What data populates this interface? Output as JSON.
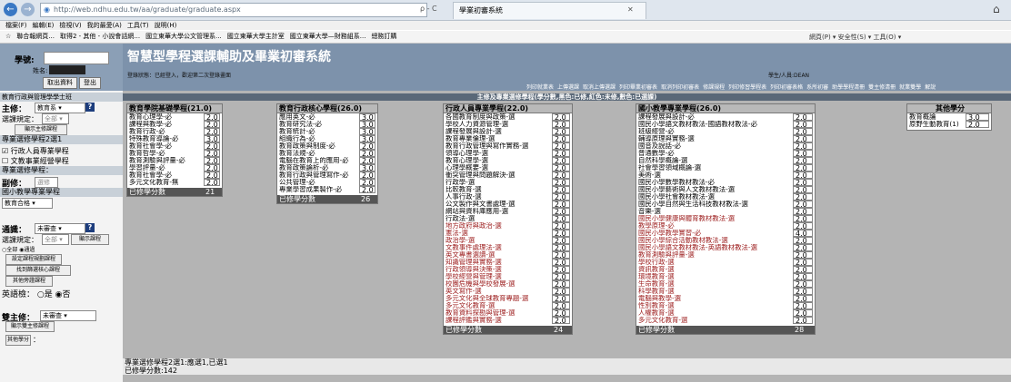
{
  "browser": {
    "url": "http://web.ndhu.edu.tw/aa/graduate/graduate.aspx",
    "tab_title": "學業初審系統",
    "addr_tools": "ρ - C",
    "menu": [
      "檔案(F)",
      "編輯(E)",
      "檢視(V)",
      "我的最愛(A)",
      "工具(T)",
      "說明(H)"
    ],
    "favorites": [
      "聯合報網頁...",
      "取得2 - 其他 - 小說會話網...",
      "國立東華大學公文管理系...",
      "國立東華大學主計室",
      "國立東華大學—財務組系...",
      "總務訂購"
    ],
    "command_bar": "網頁(P) ▾  安全性(S) ▾  工具(O) ▾"
  },
  "header": {
    "system_title": "智慧型學程選課輔助及畢業初審系統",
    "login_info": "登錄狀態：已經登入，歡迎第二次登錄畫面",
    "user_info": "學生/人員:DEAN",
    "sid_label": "學號:",
    "name_label": "姓名:",
    "fetch_button": "取出資料",
    "logout_button": "登出",
    "top_links": [
      "列印就業表",
      "上傳選課",
      "取消上傳選課",
      "列印畢業初審表",
      "取消列印初審表",
      "修課規程",
      "列印修習學程表",
      "列印初審表格",
      "系所初審",
      "助學學程清冊",
      "雙主修清冊",
      "就業雙學",
      "解說"
    ]
  },
  "left": {
    "section_title": "教育行政與管理學學士班",
    "major_label": "主修：",
    "major_value": "教育系",
    "cond_label": "選課規定：",
    "cond_value": "全部",
    "show_major_btn": "顯示主修課程",
    "program_count": "專業選修學程2選1",
    "program1": "行政人員專業學程",
    "program2": "文教事業經營學程",
    "program_title": "專業選修學程：",
    "double_label": "副修：",
    "double_value": "選修",
    "elective_title": "國小教學專業學程",
    "elective_value": "教育合格",
    "general_label": "通識：",
    "general_value": "未審查",
    "general_cond_label": "選課規定：",
    "general_cond_value": "全部",
    "show_general_btn": "顯示課程",
    "radio1": "全部",
    "radio2": "通過",
    "btn1": "設定課程規劃課程",
    "btn2": "找到篩選核心課程",
    "btn3": "其他旁證課程",
    "english_label": "英語檢：",
    "yes": "是",
    "no": "否",
    "dual_label": "雙主修：",
    "dual_value": "未審查",
    "show_dual_btn": "顯示雙主修課程",
    "other_btn": "其他學分",
    "other_suffix": "："
  },
  "main": {
    "heading": "主修及專業選修學程(學分數,黑色:已修,紅色:未修,數色:已選課)",
    "footer_line1": "專業選修學程2選1:應選1,已選1",
    "footer_line2": "已修學分數:142",
    "total_label": "已修學分數",
    "categories": [
      {
        "title": "教育學院基礎學程(21.0)",
        "total": "21",
        "courses": [
          {
            "name": "教育心理學-必",
            "credit": "2.0",
            "taken": true
          },
          {
            "name": "課程與教學-必",
            "credit": "2.0",
            "taken": true
          },
          {
            "name": "教育行政-必",
            "credit": "2.0",
            "taken": true
          },
          {
            "name": "特殊教育導論-必",
            "credit": "3.0",
            "taken": true
          },
          {
            "name": "教育社會學-必",
            "credit": "2.0",
            "taken": true
          },
          {
            "name": "教育哲學-必",
            "credit": "2.0",
            "taken": true
          },
          {
            "name": "教育測驗與評量-必",
            "credit": "2.0",
            "taken": true
          },
          {
            "name": "學習評量-必",
            "credit": "2.0",
            "taken": true
          },
          {
            "name": "教育社會學-必",
            "credit": "2.0",
            "taken": true
          },
          {
            "name": "多元文化教育-無",
            "credit": "2.0",
            "taken": true
          }
        ]
      },
      {
        "title": "教育行政核心學程(26.0)",
        "total": "26",
        "courses": [
          {
            "name": "應用英文-必",
            "credit": "3.0",
            "taken": true
          },
          {
            "name": "教育研究法-必",
            "credit": "3.0",
            "taken": true
          },
          {
            "name": "教育統計-必",
            "credit": "3.0",
            "taken": true
          },
          {
            "name": "組織行為-必",
            "credit": "3.0",
            "taken": true
          },
          {
            "name": "教育政策與制度-必",
            "credit": "2.0",
            "taken": true
          },
          {
            "name": "教育法規-必",
            "credit": "2.0",
            "taken": true
          },
          {
            "name": "電腦在教育上的應用-必",
            "credit": "2.0",
            "taken": true
          },
          {
            "name": "教育政策論析-必",
            "credit": "3.0",
            "taken": true
          },
          {
            "name": "教育行政與管理寫作-必",
            "credit": "2.0",
            "taken": true
          },
          {
            "name": "公共管理-必",
            "credit": "2.0",
            "taken": true
          },
          {
            "name": "專業學習成果製作-必",
            "credit": "2.0",
            "taken": true
          }
        ]
      },
      {
        "title": "行政人員專業學程(22.0)",
        "total": "24",
        "courses": [
          {
            "name": "各國教育制度與政策-選",
            "credit": "2.0",
            "taken": true
          },
          {
            "name": "學校人力資源管理-選",
            "credit": "2.0",
            "taken": true
          },
          {
            "name": "課程發展與設計-選",
            "credit": "2.0",
            "taken": true
          },
          {
            "name": "教育專業倫理-選",
            "credit": "2.0",
            "taken": true
          },
          {
            "name": "教育行政管理與寫作實務-選",
            "credit": "2.0",
            "taken": true
          },
          {
            "name": "領導心理學-選",
            "credit": "2.0",
            "taken": true
          },
          {
            "name": "教育心理學-選",
            "credit": "2.0",
            "taken": true
          },
          {
            "name": "心理學概要-選",
            "credit": "2.0",
            "taken": true
          },
          {
            "name": "衝突管理與問題解決-選",
            "credit": "2.0",
            "taken": true
          },
          {
            "name": "行政學-選",
            "credit": "2.0",
            "taken": true
          },
          {
            "name": "比較教育-選",
            "credit": "2.0",
            "taken": true
          },
          {
            "name": "人事行政-選",
            "credit": "2.0",
            "taken": true
          },
          {
            "name": "公文製作與文書處理-選",
            "credit": "2.0",
            "taken": true
          },
          {
            "name": "網站與資料庫應用-選",
            "credit": "2.0",
            "taken": true
          },
          {
            "name": "行政法-選",
            "credit": "2.0",
            "taken": true
          },
          {
            "name": "地方政府與政治-選",
            "credit": "2.0",
            "taken": false
          },
          {
            "name": "憲法-選",
            "credit": "2.0",
            "taken": false
          },
          {
            "name": "政治學-選",
            "credit": "2.0",
            "taken": false
          },
          {
            "name": "文教事件處理法-選",
            "credit": "2.0",
            "taken": false
          },
          {
            "name": "英文專書選讀-選",
            "credit": "2.0",
            "taken": false
          },
          {
            "name": "知識管理與實務-選",
            "credit": "2.0",
            "taken": false
          },
          {
            "name": "行政領導與決策-選",
            "credit": "2.0",
            "taken": false
          },
          {
            "name": "學校經營與管理-選",
            "credit": "2.0",
            "taken": false
          },
          {
            "name": "校園危機與學校發展-選",
            "credit": "2.0",
            "taken": false
          },
          {
            "name": "英文寫作-選",
            "credit": "2.0",
            "taken": false
          },
          {
            "name": "多元文化與全球教育專題-選",
            "credit": "2.0",
            "taken": false
          },
          {
            "name": "多元文化教育-選",
            "credit": "2.0",
            "taken": false
          },
          {
            "name": "教育資料探勘與管理-選",
            "credit": "2.0",
            "taken": false
          },
          {
            "name": "課程評鑑與實務-選",
            "credit": "2.0",
            "taken": false
          }
        ]
      },
      {
        "title": "國小教學專業學程(26.0)",
        "total": "28",
        "courses": [
          {
            "name": "課程發展與設計-必",
            "credit": "2.0",
            "taken": true
          },
          {
            "name": "國民小學語文教材教法-國語教材教法-必",
            "credit": "2.0",
            "taken": true
          },
          {
            "name": "班級經營-必",
            "credit": "2.0",
            "taken": true
          },
          {
            "name": "輔導原理與實務-選",
            "credit": "2.0",
            "taken": true
          },
          {
            "name": "國音及說話-必",
            "credit": "2.0",
            "taken": true
          },
          {
            "name": "普通數學-必",
            "credit": "2.0",
            "taken": true
          },
          {
            "name": "自然科學概論-選",
            "credit": "2.0",
            "taken": true
          },
          {
            "name": "社會學習領域概論-選",
            "credit": "2.0",
            "taken": true
          },
          {
            "name": "美術-選",
            "credit": "2.0",
            "taken": true
          },
          {
            "name": "國民小學數學教材教法-必",
            "credit": "2.0",
            "taken": true
          },
          {
            "name": "國民小學藝術與人文教材教法-選",
            "credit": "2.0",
            "taken": true
          },
          {
            "name": "國民小學社會教材教法-選",
            "credit": "2.0",
            "taken": true
          },
          {
            "name": "國民小學自然與生活科技教材教法-選",
            "credit": "2.0",
            "taken": true
          },
          {
            "name": "音樂-選",
            "credit": "2.0",
            "taken": true
          },
          {
            "name": "國民小學健康與體育教材教法-選",
            "credit": "2.0",
            "taken": false
          },
          {
            "name": "教學原理-必",
            "credit": "2.0",
            "taken": false
          },
          {
            "name": "國民小學教學實習-必",
            "credit": "4.0",
            "taken": false
          },
          {
            "name": "國民小學綜合活動教材教法-選",
            "credit": "2.0",
            "taken": false
          },
          {
            "name": "國民小學語文教材教法-英語教材教法-選",
            "credit": "2.0",
            "taken": false
          },
          {
            "name": "教育測驗與評量-選",
            "credit": "2.0",
            "taken": false
          },
          {
            "name": "學校行政-選",
            "credit": "2.0",
            "taken": false
          },
          {
            "name": "資訊教育-選",
            "credit": "2.0",
            "taken": false
          },
          {
            "name": "環境教育-選",
            "credit": "2.0",
            "taken": false
          },
          {
            "name": "生命教育-選",
            "credit": "2.0",
            "taken": false
          },
          {
            "name": "科學教育-選",
            "credit": "2.0",
            "taken": false
          },
          {
            "name": "電腦與教學-選",
            "credit": "2.0",
            "taken": false
          },
          {
            "name": "性別教育-選",
            "credit": "2.0",
            "taken": false
          },
          {
            "name": "人權教育-選",
            "credit": "2.0",
            "taken": false
          },
          {
            "name": "多元文化教育-選",
            "credit": "2.0",
            "taken": false
          }
        ]
      }
    ],
    "other": {
      "title": "其他學分",
      "courses": [
        {
          "name": "教育概論",
          "credit": "3.0",
          "taken": true
        },
        {
          "name": "原野生動教育(1)",
          "credit": "2.0",
          "taken": true
        }
      ]
    }
  },
  "colors": {
    "header_bg": "#7d92ab",
    "untaken": "#9b1a1a",
    "main_bg": "#b4b4b4"
  }
}
